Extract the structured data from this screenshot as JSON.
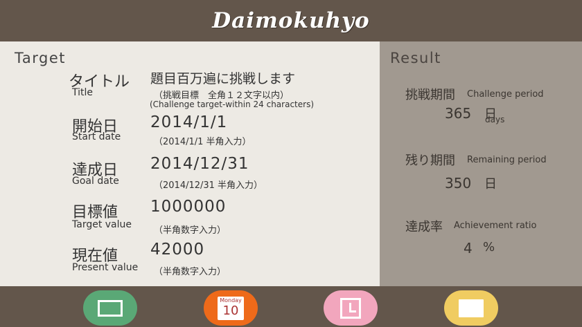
{
  "app": {
    "title": "Daimokuhyo"
  },
  "target": {
    "heading": "Target",
    "title_label_ja": "タイトル",
    "title_label_en": "Title",
    "title_value": "題目百万遍に挑戦します",
    "title_hint_ja": "（挑戦目標　全角１２文字以内）",
    "title_hint_en": "(Challenge target-within 24 characters)",
    "start_label_ja": "開始日",
    "start_label_en": "Start date",
    "start_value": "2014/1/1",
    "start_hint": "（2014/1/1 半角入力）",
    "goal_label_ja": "達成日",
    "goal_label_en": "Goal date",
    "goal_value": "2014/12/31",
    "goal_hint": "（2014/12/31 半角入力）",
    "target_label_ja": "目標値",
    "target_label_en": "Target value",
    "target_value": "1000000",
    "target_hint": "（半角数字入力）",
    "present_label_ja": "現在値",
    "present_label_en": "Present value",
    "present_value": "42000",
    "present_hint": "（半角数字入力）"
  },
  "result": {
    "heading": "Result",
    "challenge_label_ja": "挑戦期間",
    "challenge_label_en": "Challenge period",
    "challenge_value": "365",
    "challenge_unit_ja": "日",
    "challenge_unit_en": "days",
    "remaining_label_ja": "残り期間",
    "remaining_label_en": "Remaining period",
    "remaining_value": "350",
    "remaining_unit_ja": "日",
    "achievement_label_ja": "達成率",
    "achievement_label_en": "Achievement ratio",
    "achievement_value": "4",
    "achievement_unit": "%"
  },
  "footer": {
    "calendar_month": "Monday",
    "calendar_day": "10",
    "colors": {
      "green": "#5aa876",
      "orange": "#ee6a1a",
      "pink": "#f2a6bd",
      "yellow": "#f0cc61"
    }
  }
}
